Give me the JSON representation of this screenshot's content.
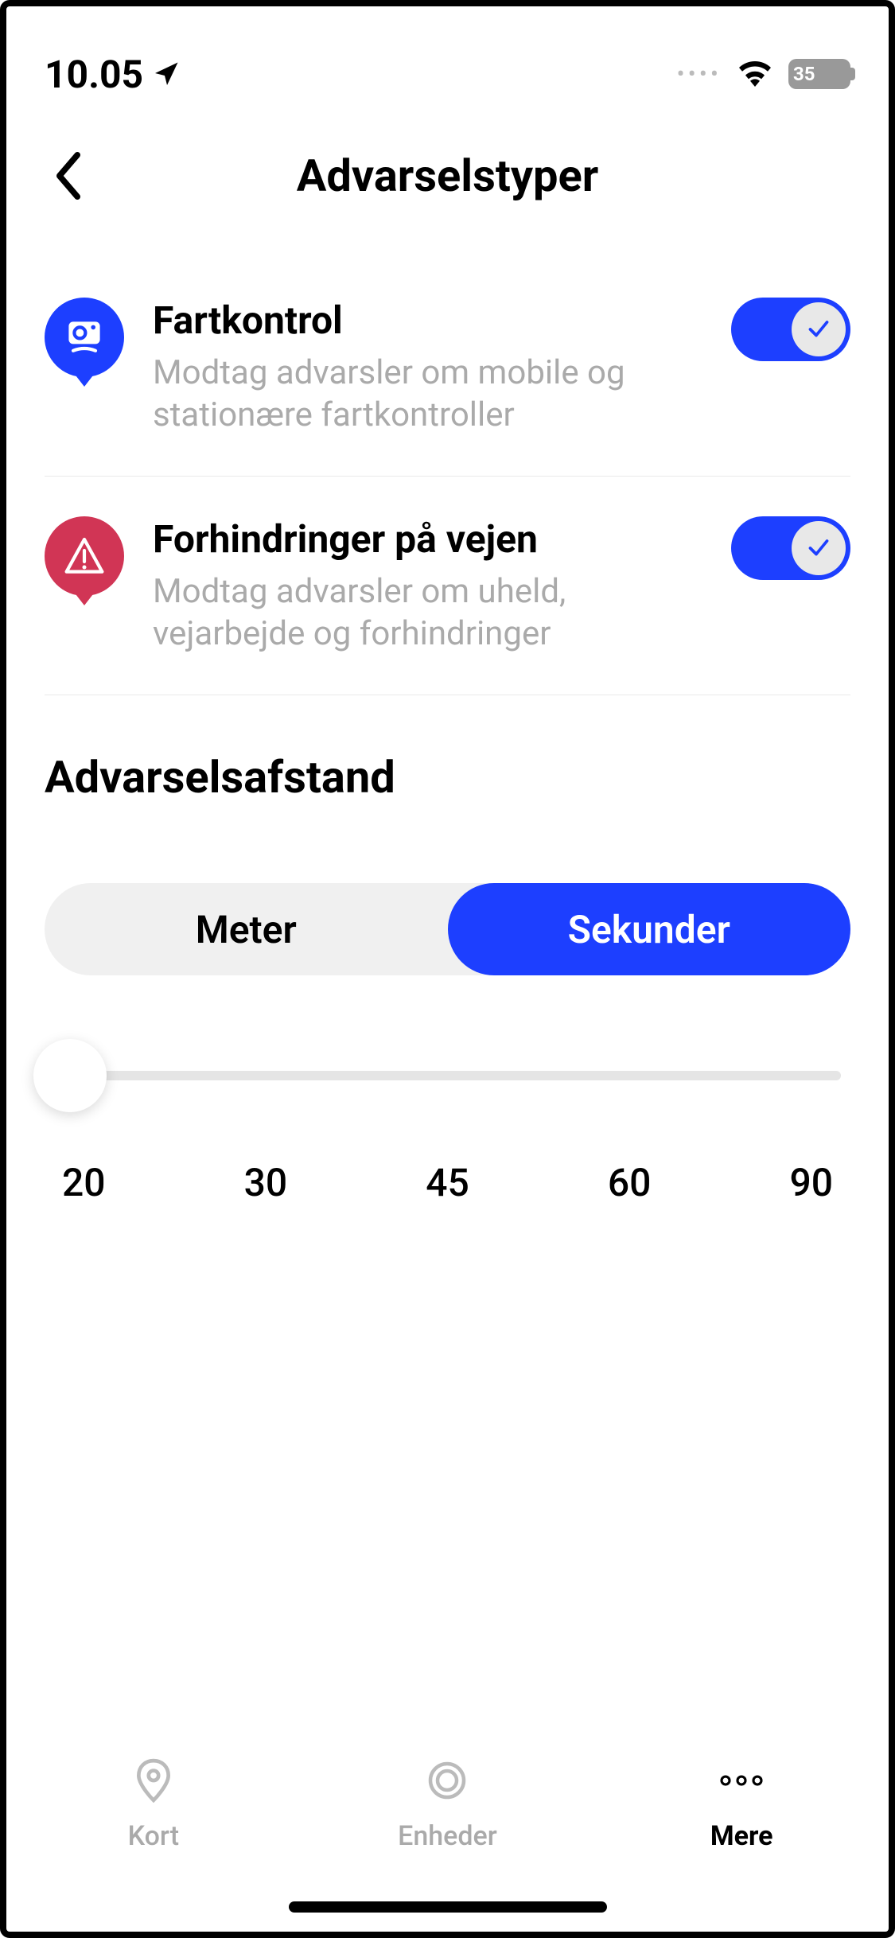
{
  "statusBar": {
    "time": "10.05",
    "batteryLevel": "35"
  },
  "header": {
    "title": "Advarselstyper"
  },
  "settings": [
    {
      "title": "Fartkontrol",
      "description": "Modtag advarsler om mobile og stationære fartkontroller",
      "enabled": true
    },
    {
      "title": "Forhindringer på vejen",
      "description": "Modtag advarsler om uheld, vejarbejde og  forhindringer",
      "enabled": true
    }
  ],
  "distance": {
    "title": "Advarselsafstand",
    "segments": {
      "option1": "Meter",
      "option2": "Sekunder",
      "selected": 1
    },
    "sliderTicks": [
      "20",
      "30",
      "45",
      "60",
      "90"
    ]
  },
  "tabBar": {
    "tab1": "Kort",
    "tab2": "Enheder",
    "tab3": "Mere"
  }
}
